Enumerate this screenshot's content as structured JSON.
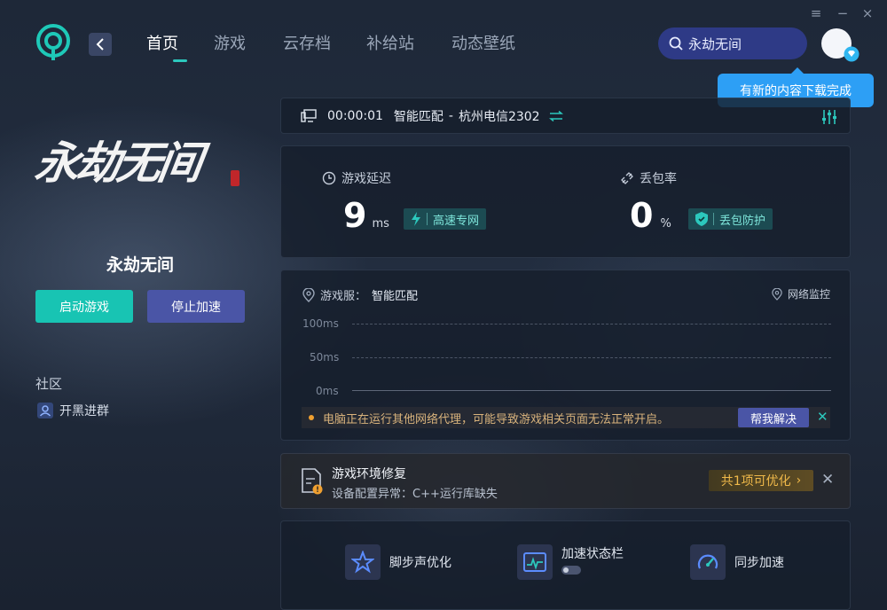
{
  "app": {
    "nav": [
      "首页",
      "游戏",
      "云存档",
      "补给站",
      "动态壁纸"
    ],
    "active_nav": 0,
    "search_value": "永劫无间",
    "tooltip": "有新的内容下载完成",
    "window_controls": [
      "≡",
      "−",
      "×"
    ]
  },
  "game": {
    "logo_text": "永劫无间",
    "name": "永劫无间",
    "start_label": "启动游戏",
    "stop_label": "停止加速"
  },
  "community": {
    "title": "社区",
    "items": [
      "开黑进群"
    ]
  },
  "connection": {
    "time": "00:00:01",
    "mode": "智能匹配",
    "separator": "-",
    "node": "杭州电信2302"
  },
  "stats": {
    "latency_label": "游戏延迟",
    "latency_value": "9",
    "latency_unit": "ms",
    "latency_tag": "高速专网",
    "loss_label": "丢包率",
    "loss_value": "0",
    "loss_unit": "%",
    "loss_tag": "丢包防护"
  },
  "server": {
    "label": "游戏服：",
    "value": "智能匹配",
    "monitor": "网络监控",
    "axis": [
      "100ms",
      "50ms",
      "0ms"
    ],
    "warning": "电脑正在运行其他网络代理，可能导致游戏相关页面无法正常开启。",
    "help": "帮我解决"
  },
  "repair": {
    "title": "游戏环境修复",
    "subtitle": "设备配置异常：C++运行库缺失",
    "button": "共1项可优化"
  },
  "tools": [
    {
      "label": "脚步声优化",
      "icon": "star-icon"
    },
    {
      "label": "加速状态栏",
      "icon": "pulse-icon"
    },
    {
      "label": "同步加速",
      "icon": "gauge-icon"
    }
  ],
  "colors": {
    "accent": "#18c4b3",
    "primary": "#4a55a6",
    "tooltip": "#2d9ff5",
    "search_bg": "#2e3a86",
    "warning": "#f0b94a"
  }
}
